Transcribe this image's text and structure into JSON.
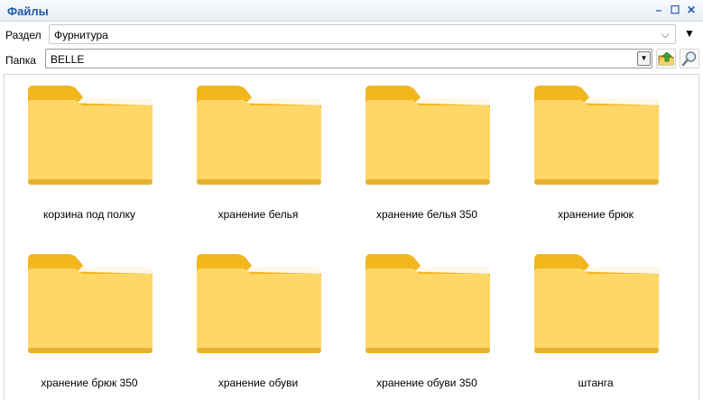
{
  "window": {
    "title": "Файлы",
    "controls": [
      "–",
      "☐",
      "✕"
    ]
  },
  "section": {
    "label": "Раздел",
    "value": "Фурнитура"
  },
  "folder_field": {
    "label": "Папка",
    "value": "BELLE"
  },
  "folders": [
    {
      "name": "корзина под полку"
    },
    {
      "name": "хранение белья"
    },
    {
      "name": "хранение белья 350"
    },
    {
      "name": "хранение брюк"
    },
    {
      "name": "хранение брюк 350"
    },
    {
      "name": "хранение обуви"
    },
    {
      "name": "хранение обуви 350"
    },
    {
      "name": "штанга"
    }
  ],
  "colors": {
    "title": "#1f5aa6",
    "folder_back": "#f2b61f",
    "folder_front": "#fed767"
  }
}
